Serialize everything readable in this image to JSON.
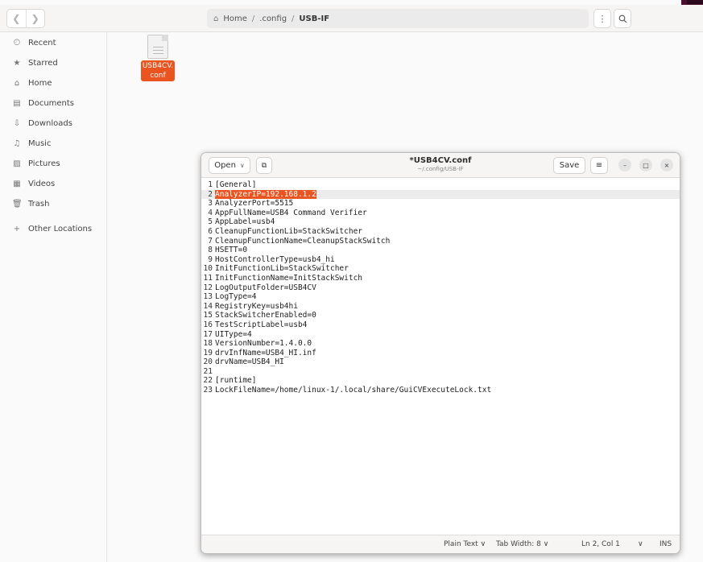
{
  "files": {
    "path": {
      "home": "Home",
      "sep": "/",
      "seg1": ".config",
      "seg2": "USB-IF"
    },
    "sidebar": [
      {
        "name": "recent",
        "label": "Recent",
        "icon": "clock-icon"
      },
      {
        "name": "starred",
        "label": "Starred",
        "icon": "star-icon"
      },
      {
        "name": "home",
        "label": "Home",
        "icon": "home-icon"
      },
      {
        "name": "documents",
        "label": "Documents",
        "icon": "document-icon"
      },
      {
        "name": "downloads",
        "label": "Downloads",
        "icon": "download-icon"
      },
      {
        "name": "music",
        "label": "Music",
        "icon": "music-icon"
      },
      {
        "name": "pictures",
        "label": "Pictures",
        "icon": "picture-icon"
      },
      {
        "name": "videos",
        "label": "Videos",
        "icon": "video-icon"
      },
      {
        "name": "trash",
        "label": "Trash",
        "icon": "trash-icon"
      }
    ],
    "other_locations": "Other Locations",
    "file": {
      "line1": "USB4CV.",
      "line2": "conf"
    }
  },
  "editor": {
    "open_label": "Open",
    "title": "*USB4CV.conf",
    "subtitle": "~/.config/USB-IF",
    "save_label": "Save",
    "highlight": "AnalyzerIP=192.168.1.2",
    "lines": [
      "[General]",
      "AnalyzerIP=192.168.1.2",
      "AnalyzerPort=5515",
      "AppFullName=USB4 Command Verifier",
      "AppLabel=usb4",
      "CleanupFunctionLib=StackSwitcher",
      "CleanupFunctionName=CleanupStackSwitch",
      "HSETT=0",
      "HostControllerType=usb4_hi",
      "InitFunctionLib=StackSwitcher",
      "InitFunctionName=InitStackSwitch",
      "LogOutputFolder=USB4CV",
      "LogType=4",
      "RegistryKey=usb4hi",
      "StackSwitcherEnabled=0",
      "TestScriptLabel=usb4",
      "UIType=4",
      "VersionNumber=1.4.0.0",
      "drvInfName=USB4_HI.inf",
      "drvName=USB4_HI",
      "",
      "[runtime]",
      "LockFileName=/home/linux-1/.local/share/GuiCVExecuteLock.txt"
    ],
    "status": {
      "lang": "Plain Text",
      "tab": "Tab Width: 8",
      "pos": "Ln 2, Col 1",
      "mode": "INS"
    }
  }
}
